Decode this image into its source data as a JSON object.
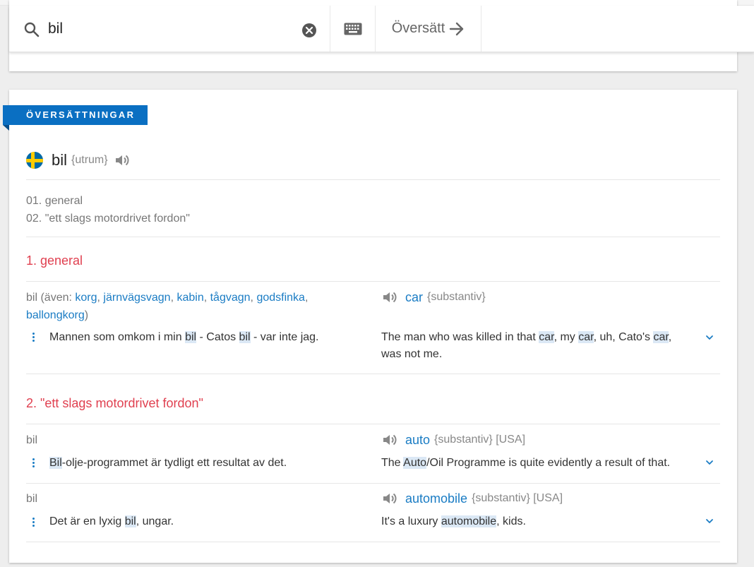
{
  "search": {
    "query": "bil",
    "translate_label": "Översätt"
  },
  "section_label": "ÖVERSÄTTNINGAR",
  "headword": {
    "word": "bil",
    "gender": "{utrum}",
    "flag": "swedish-flag"
  },
  "sense_list": [
    "01. general",
    "02. \"ett slags motordrivet fordon\""
  ],
  "senses": [
    {
      "title": "1. general",
      "entries": [
        {
          "src_word": "bil",
          "src_also_prefix": "(även:",
          "src_also": [
            "korg",
            "järnvägsvagn",
            "kabin",
            "tågvagn",
            "godsfinka",
            "ballongkorg"
          ],
          "src_also_suffix": ")",
          "tgt_word": "car",
          "tgt_meta": "{substantiv}",
          "ex_src": [
            "Mannen som omkom i min ",
            "bil",
            " - Catos ",
            "bil",
            " - var inte jag."
          ],
          "ex_tgt": [
            "The man who was killed in that ",
            "car",
            ", my ",
            "car",
            ", uh, Cato's ",
            "car",
            ", was not me."
          ]
        }
      ]
    },
    {
      "title": "2. \"ett slags motordrivet fordon\"",
      "entries": [
        {
          "src_word": "bil",
          "tgt_word": "auto",
          "tgt_meta": "{substantiv} [USA]",
          "ex_src": [
            "",
            "Bil",
            "-olje-programmet är tydligt ett resultat av det."
          ],
          "ex_tgt": [
            "The ",
            "Auto",
            "/Oil Programme is quite evidently a result of that."
          ]
        },
        {
          "src_word": "bil",
          "tgt_word": "automobile",
          "tgt_meta": "{substantiv} [USA]",
          "ex_src": [
            "Det är en lyxig ",
            "bil",
            ", ungar."
          ],
          "ex_tgt": [
            "It's a luxury ",
            "automobile",
            ", kids."
          ]
        }
      ]
    }
  ],
  "colors": {
    "accent": "#0a6fc2",
    "link": "#1a7cc4",
    "sense_title": "#e04050",
    "highlight": "#dbe8f5"
  }
}
